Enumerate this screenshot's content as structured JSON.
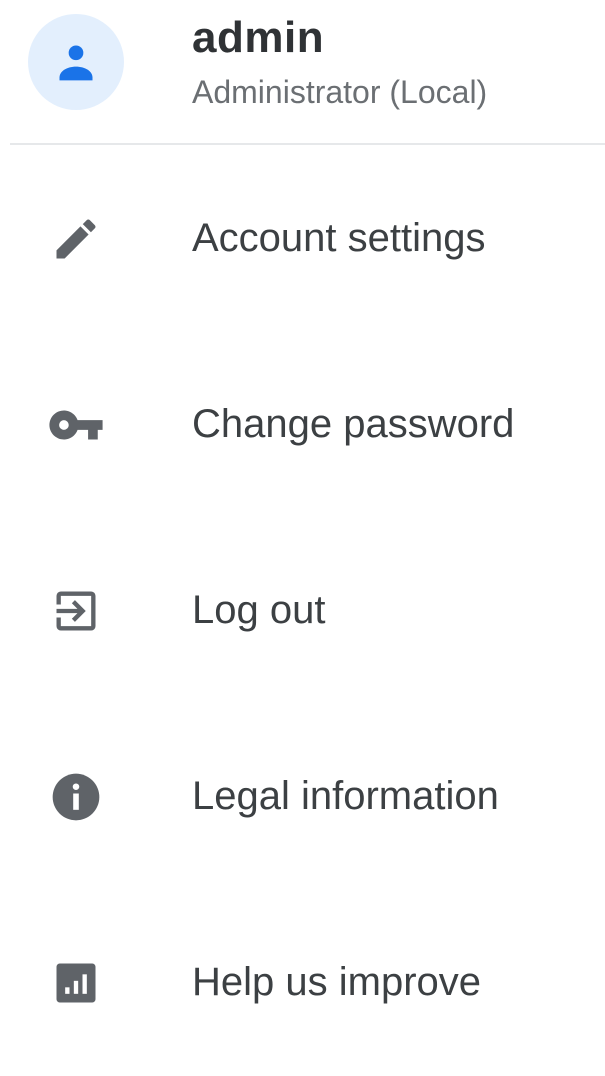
{
  "user": {
    "name": "admin",
    "role": "Administrator (Local)",
    "avatar_icon": "person-icon",
    "avatar_color": "#1a73e8",
    "avatar_background": "#e3effd"
  },
  "menu": {
    "items": [
      {
        "id": "account-settings",
        "label": "Account settings",
        "icon": "pencil-icon"
      },
      {
        "id": "change-password",
        "label": "Change password",
        "icon": "key-icon"
      },
      {
        "id": "log-out",
        "label": "Log out",
        "icon": "logout-icon"
      },
      {
        "id": "legal-information",
        "label": "Legal information",
        "icon": "info-icon"
      },
      {
        "id": "help-us-improve",
        "label": "Help us improve",
        "icon": "analytics-icon"
      }
    ],
    "icon_color": "#5f6368"
  }
}
